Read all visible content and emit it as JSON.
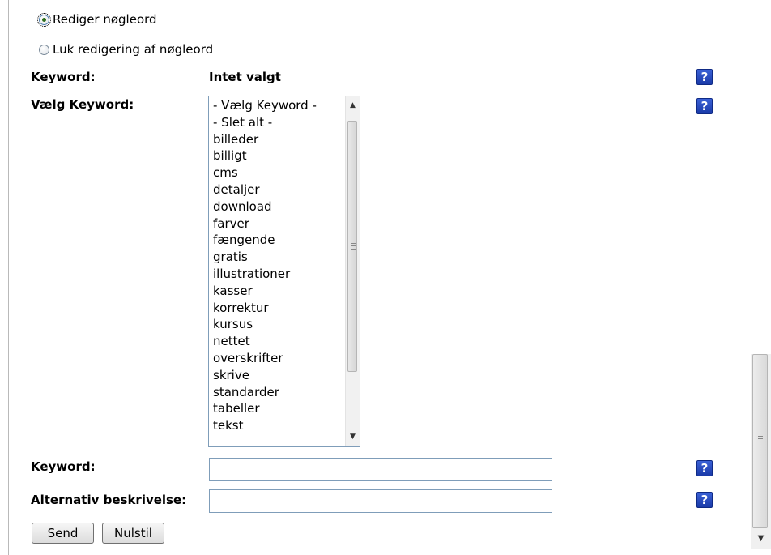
{
  "radios": [
    {
      "label": "Rediger nøgleord",
      "checked": true
    },
    {
      "label": "Luk redigering af nøgleord",
      "checked": false
    }
  ],
  "keyword_row": {
    "label": "Keyword:",
    "value": "Intet valgt"
  },
  "select_row": {
    "label": "Vælg Keyword:",
    "options": [
      "- Vælg Keyword -",
      "- Slet alt -",
      "billeder",
      "billigt",
      "cms",
      "detaljer",
      "download",
      "farver",
      "fængende",
      "gratis",
      "illustrationer",
      "kasser",
      "korrektur",
      "kursus",
      "nettet",
      "overskrifter",
      "skrive",
      "standarder",
      "tabeller",
      "tekst"
    ]
  },
  "keyword_input": {
    "label": "Keyword:",
    "value": ""
  },
  "alt_input": {
    "label": "Alternativ beskrivelse:",
    "value": ""
  },
  "buttons": {
    "send": "Send",
    "reset": "Nulstil"
  },
  "help": {
    "icon": "help-question-icon",
    "glyph": "?"
  },
  "scroll": {
    "up": "▲",
    "down": "▼"
  }
}
